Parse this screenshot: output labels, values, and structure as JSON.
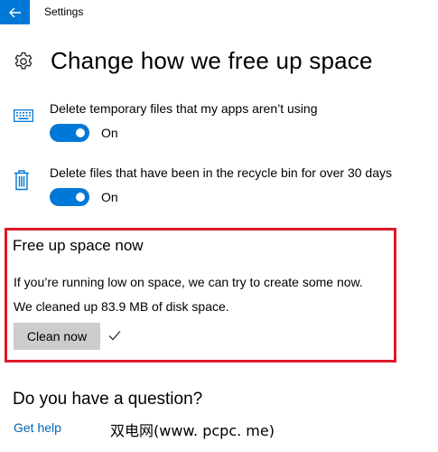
{
  "app": {
    "title": "Settings"
  },
  "header": {
    "title": "Change how we free up space",
    "icon": "gear-icon"
  },
  "settings": [
    {
      "label": "Delete temporary files that my apps aren’t using",
      "state": "On",
      "icon": "keyboard-icon"
    },
    {
      "label": "Delete files that have been in the recycle bin for over 30 days",
      "state": "On",
      "icon": "trash-icon"
    }
  ],
  "free_up": {
    "title": "Free up space now",
    "description": "If you’re running low on space, we can try to create some now.",
    "result": "We cleaned up 83.9 MB of disk space.",
    "button_label": "Clean now",
    "highlight_color": "#e0192b"
  },
  "question": {
    "title": "Do you have a question?",
    "link": "Get help"
  },
  "watermark": "双电网(www. pcpc. me)",
  "colors": {
    "accent": "#0078d7",
    "link": "#0067b8",
    "button_bg": "#cccccc"
  }
}
